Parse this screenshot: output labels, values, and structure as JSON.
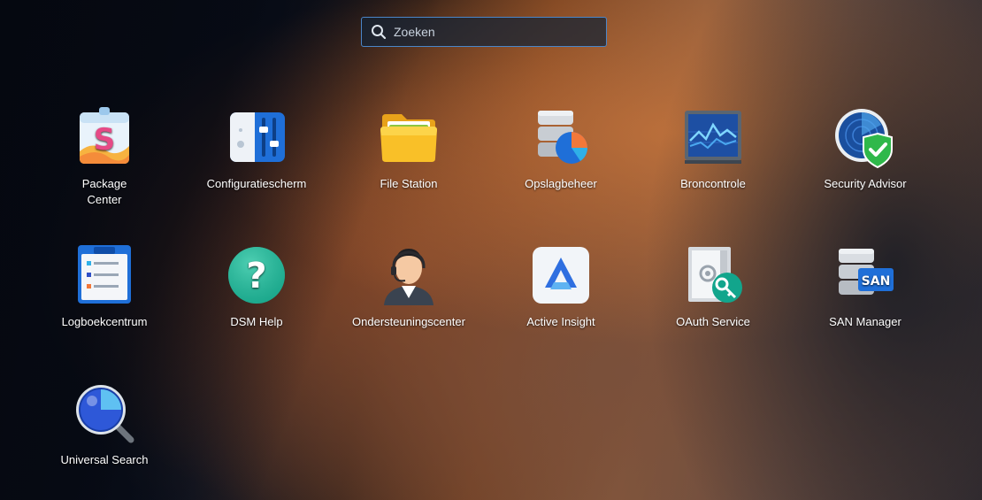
{
  "search": {
    "placeholder": "Zoeken"
  },
  "apps": [
    {
      "label": "Package\nCenter",
      "icon": "package-center-icon"
    },
    {
      "label": "Configuratiescherm",
      "icon": "control-panel-icon"
    },
    {
      "label": "File Station",
      "icon": "folder-icon"
    },
    {
      "label": "Opslagbeheer",
      "icon": "storage-manager-icon"
    },
    {
      "label": "Broncontrole",
      "icon": "resource-monitor-icon"
    },
    {
      "label": "Security Advisor",
      "icon": "security-advisor-icon"
    },
    {
      "label": "Logboekcentrum",
      "icon": "log-center-icon"
    },
    {
      "label": "DSM Help",
      "icon": "help-icon"
    },
    {
      "label": "Ondersteuningscenter",
      "icon": "support-center-icon"
    },
    {
      "label": "Active Insight",
      "icon": "active-insight-icon"
    },
    {
      "label": "OAuth Service",
      "icon": "oauth-service-icon"
    },
    {
      "label": "SAN Manager",
      "icon": "san-manager-icon"
    },
    {
      "label": "Universal Search",
      "icon": "universal-search-icon"
    }
  ]
}
